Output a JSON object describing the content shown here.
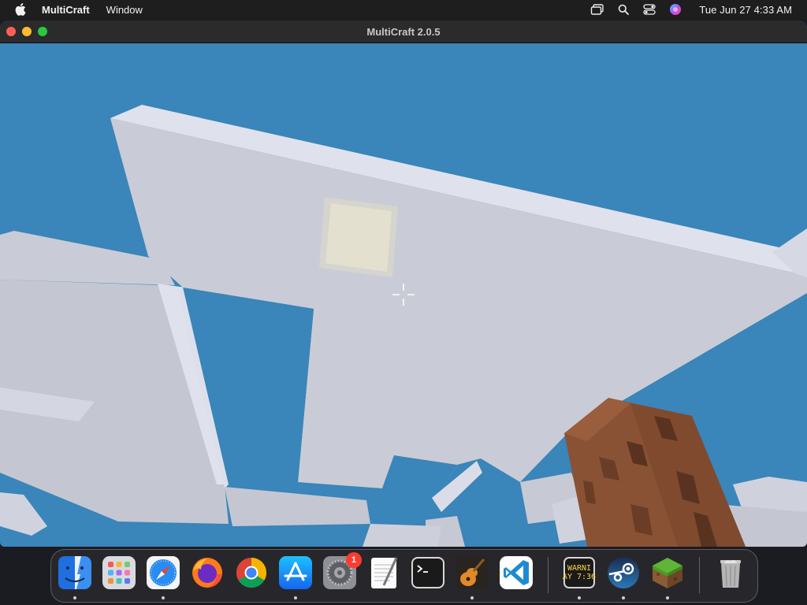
{
  "menubar": {
    "apple_icon": "apple-logo-icon",
    "app_name": "MultiCraft",
    "menus": [
      "Window"
    ],
    "status_icons": [
      "screen-mirroring-icon",
      "spotlight-search-icon",
      "control-center-icon",
      "siri-icon"
    ],
    "clock": "Tue Jun 27  4:33 AM"
  },
  "window": {
    "title": "MultiCraft 2.0.5",
    "controls": [
      "close",
      "minimize",
      "zoom"
    ]
  },
  "game": {
    "sky_color": "#3a85b9",
    "cloud_color": "#c9ccd8",
    "held_item": "oak-log-block",
    "crosshair": "crosshair-icon"
  },
  "dock": {
    "apps": [
      {
        "name": "Finder",
        "icon": "finder-icon",
        "running": true
      },
      {
        "name": "Launchpad",
        "icon": "launchpad-icon",
        "running": false
      },
      {
        "name": "Safari",
        "icon": "safari-icon",
        "running": true
      },
      {
        "name": "Firefox",
        "icon": "firefox-icon",
        "running": false
      },
      {
        "name": "Google Chrome",
        "icon": "chrome-icon",
        "running": false
      },
      {
        "name": "App Store",
        "icon": "app-store-icon",
        "running": true
      },
      {
        "name": "System Settings",
        "icon": "system-settings-icon",
        "running": false,
        "badge": "1"
      },
      {
        "name": "TextEdit",
        "icon": "textedit-icon",
        "running": false
      },
      {
        "name": "Terminal",
        "icon": "terminal-icon",
        "running": false
      },
      {
        "name": "GarageBand",
        "icon": "garageband-icon",
        "running": true
      },
      {
        "name": "Visual Studio Code",
        "icon": "vscode-icon",
        "running": false
      },
      {
        "name": "Console",
        "icon": "console-icon",
        "running": true,
        "text_lines": [
          "WARNI",
          "AY 7:36"
        ]
      },
      {
        "name": "Steam",
        "icon": "steam-icon",
        "running": true
      },
      {
        "name": "MultiCraft",
        "icon": "multicraft-icon",
        "running": true
      },
      {
        "name": "Trash",
        "icon": "trash-icon",
        "running": false
      }
    ]
  }
}
